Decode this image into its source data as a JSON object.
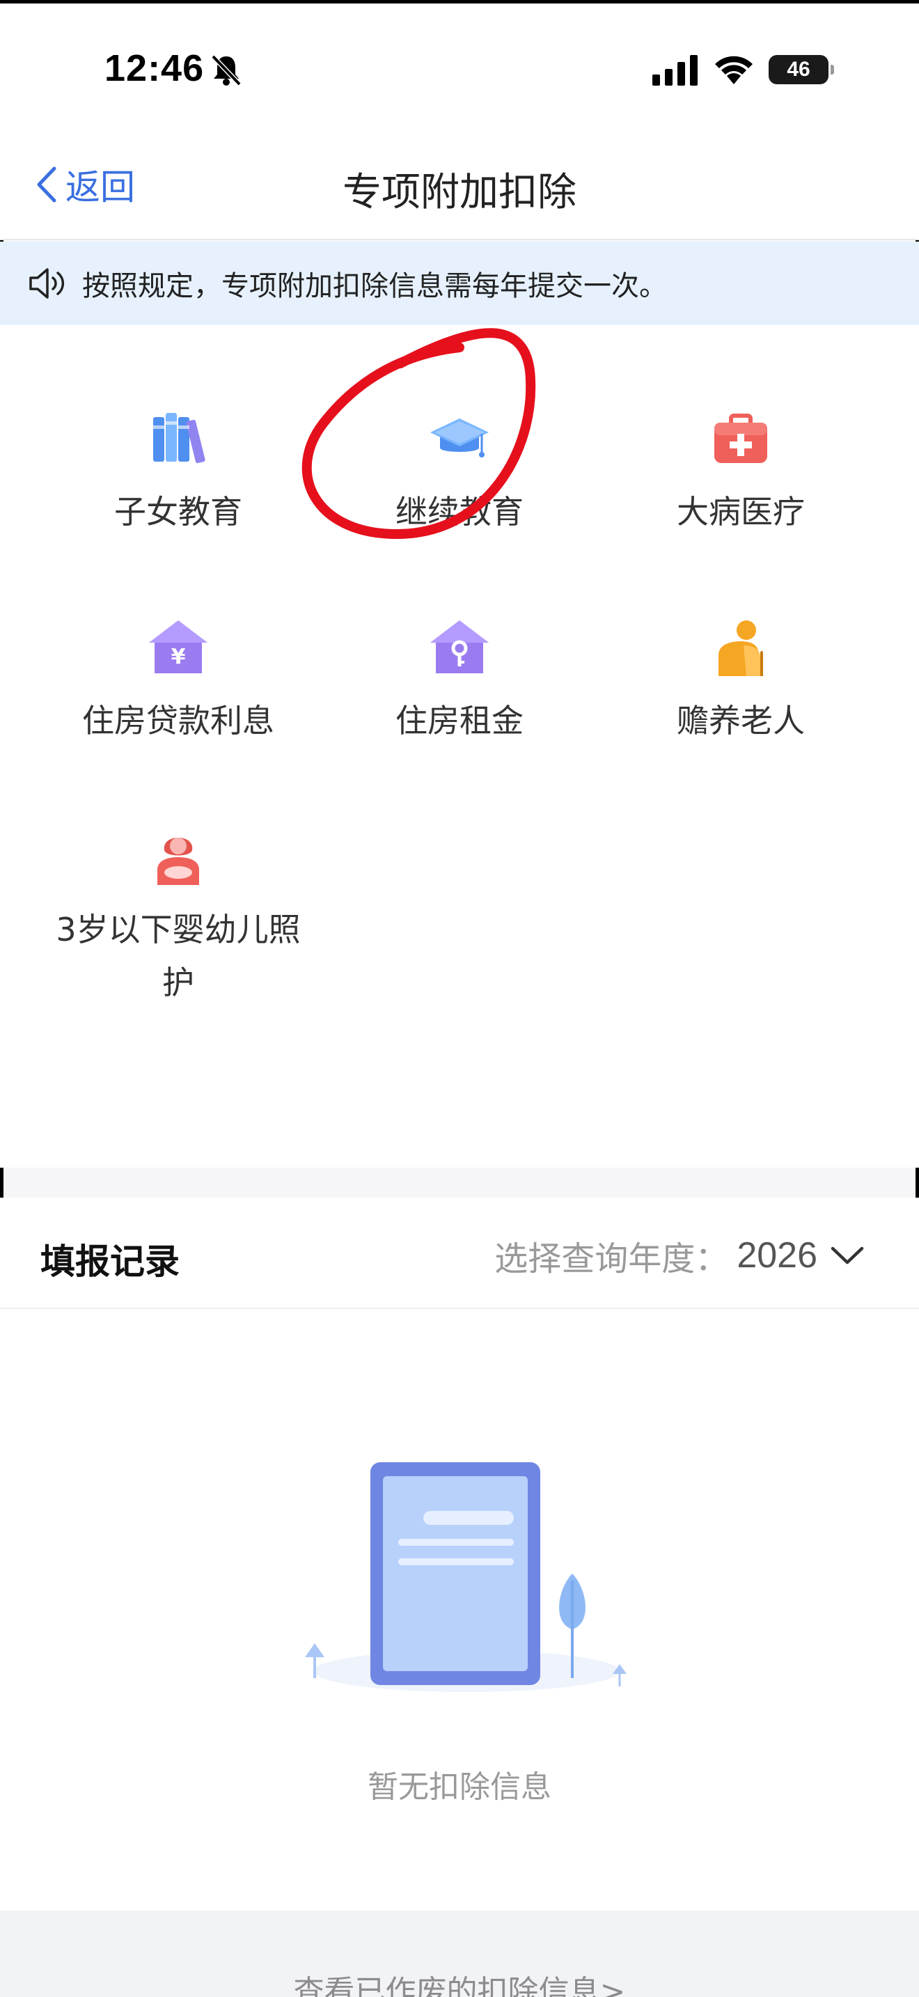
{
  "status_bar": {
    "time": "12:46",
    "battery": "46",
    "icons": [
      "bell-off-icon",
      "signal-icon",
      "wifi-icon",
      "battery-icon"
    ]
  },
  "nav": {
    "back_label": "返回",
    "title": "专项附加扣除"
  },
  "notice": {
    "icon": "speaker-icon",
    "text": "按照规定，专项附加扣除信息需每年提交一次。"
  },
  "deductions": [
    {
      "label": "子女教育",
      "icon": "books-icon",
      "color": "#5b9bf0"
    },
    {
      "label": "继续教育",
      "icon": "graduation-cap-icon",
      "color": "#5b9bf0"
    },
    {
      "label": "大病医疗",
      "icon": "medical-kit-icon",
      "color": "#f0605a"
    },
    {
      "label": "住房贷款利息",
      "icon": "house-yuan-icon",
      "color": "#9b7cf0"
    },
    {
      "label": "住房租金",
      "icon": "house-key-icon",
      "color": "#9b7cf0"
    },
    {
      "label": "赡养老人",
      "icon": "elderly-person-icon",
      "color": "#f5a623"
    },
    {
      "label": "3岁以下婴幼儿照护",
      "icon": "mother-baby-icon",
      "color": "#f0605a"
    }
  ],
  "annotation": {
    "highlighted_item": "继续教育",
    "color": "#e5101c"
  },
  "records": {
    "title": "填报记录",
    "year_label": "选择查询年度：",
    "year_value": "2026",
    "empty_text": "暂无扣除信息"
  },
  "footer": {
    "link_text": "查看已作废的扣除信息>"
  }
}
